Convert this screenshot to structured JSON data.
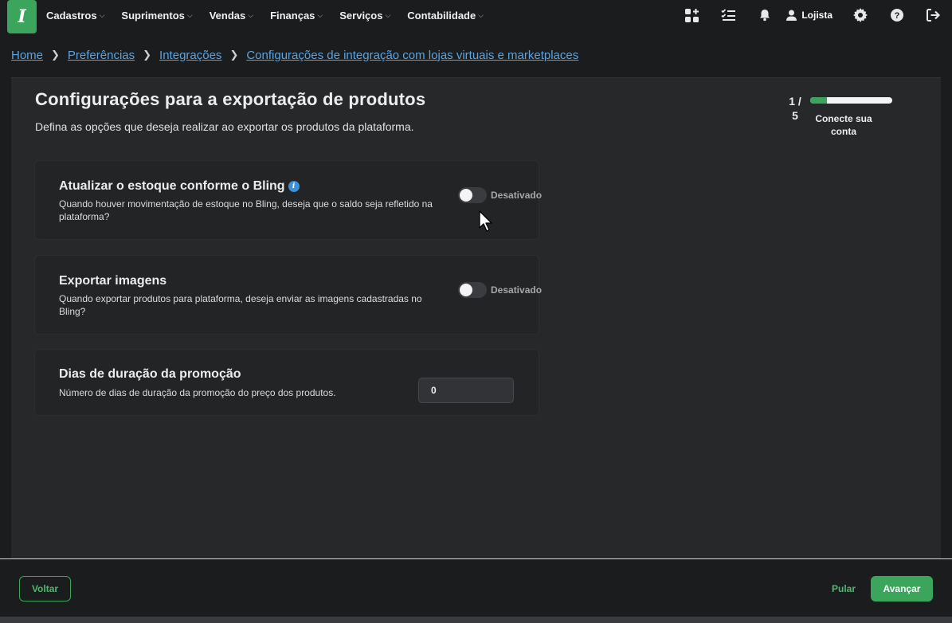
{
  "nav": {
    "logo_glyph": "I",
    "menu": [
      {
        "label": "Cadastros"
      },
      {
        "label": "Suprimentos"
      },
      {
        "label": "Vendas"
      },
      {
        "label": "Finanças"
      },
      {
        "label": "Serviços"
      },
      {
        "label": "Contabilidade"
      }
    ],
    "user_label": "Lojista",
    "icons": [
      "apps-icon",
      "checklist-icon",
      "bell-icon",
      "user-icon",
      "gear-icon",
      "help-icon",
      "logout-icon"
    ]
  },
  "breadcrumb": {
    "items": [
      {
        "label": "Home"
      },
      {
        "label": "Preferências"
      },
      {
        "label": "Integrações"
      },
      {
        "label": "Configurações de integração com lojas virtuais e marketplaces"
      }
    ]
  },
  "page": {
    "title": "Configurações para a exportação de produtos",
    "subtitle": "Defina as opções que deseja realizar ao exportar os produtos da plataforma."
  },
  "progress": {
    "step_line1": "1 /",
    "step_line2": "5",
    "step_label": "Conecte sua conta",
    "fraction": 0.2,
    "color": "#3ba55c"
  },
  "settings": {
    "stock": {
      "title": "Atualizar o estoque conforme o Bling",
      "description": "Quando houver movimentação de estoque no Bling, deseja que o saldo seja refletido na plataforma?",
      "toggle_label": "Desativado",
      "enabled": false
    },
    "images": {
      "title": "Exportar imagens",
      "description": "Quando exportar produtos para plataforma, deseja enviar as imagens cadastradas no Bling?",
      "toggle_label": "Desativado",
      "enabled": false
    },
    "promo": {
      "title": "Dias de duração da promoção",
      "description": "Número de dias de duração da promoção do preço dos produtos.",
      "value": "0"
    }
  },
  "footer": {
    "back_label": "Voltar",
    "skip_label": "Pular",
    "next_label": "Avançar"
  },
  "colors": {
    "accent": "#3ba55c",
    "link": "#5aa4e0",
    "info": "#3d8fd6"
  }
}
